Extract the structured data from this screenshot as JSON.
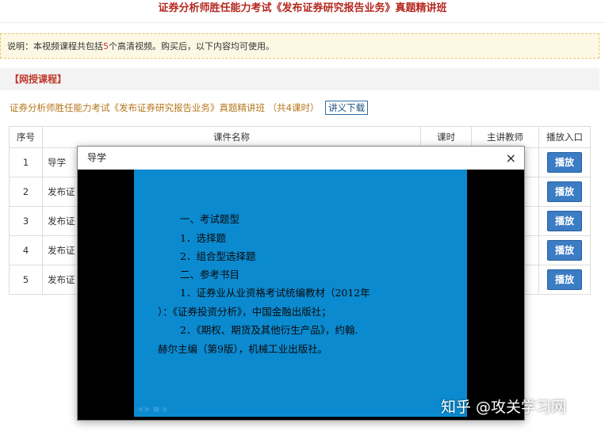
{
  "page": {
    "title": "证券分析师胜任能力考试《发布证券研究报告业务》真题精讲班"
  },
  "notice": {
    "prefix": "说明：本视频课程共包括",
    "count": "5",
    "suffix": "个高清视频。购买后，以下内容均可使用。"
  },
  "section": {
    "title": "【网授课程】"
  },
  "course": {
    "name": "证券分析师胜任能力考试《发布证券研究报告业务》真题精讲班",
    "hours": "（共4课时）",
    "download_label": "讲义下载"
  },
  "table": {
    "headers": [
      "序号",
      "课件名称",
      "课时",
      "主讲教师",
      "播放入口"
    ],
    "rows": [
      {
        "no": "1",
        "name": "导学",
        "play": "播放"
      },
      {
        "no": "2",
        "name": "发布证",
        "play": "播放"
      },
      {
        "no": "3",
        "name": "发布证",
        "play": "播放"
      },
      {
        "no": "4",
        "name": "发布证",
        "play": "播放"
      },
      {
        "no": "5",
        "name": "发布证",
        "play": "播放"
      }
    ]
  },
  "modal": {
    "title": "导学",
    "close": "×"
  },
  "slide": {
    "lines": [
      "一、考试题型",
      "1．选择题",
      "2．组合型选择题",
      "二、参考书目",
      "1．证券业从业资格考试统编教材（2012年",
      "）：《证券投资分析》，中国金融出版社；",
      "2．《期权、期货及其他衍生产品》，约翰.",
      "赫尔主编（第9版），机械工业出版社。"
    ]
  },
  "watermark": {
    "text": "知乎 @攻关学习网"
  },
  "colors": {
    "title_red": "#b5271f",
    "course_orange": "#b5761a",
    "play_blue": "#3b7cc4",
    "slide_blue": "#0b8ad0"
  }
}
